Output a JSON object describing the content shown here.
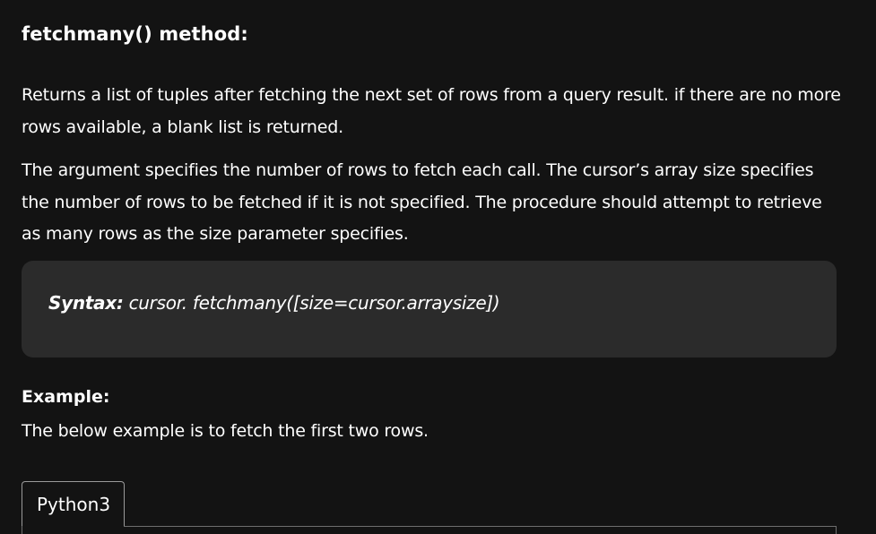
{
  "heading": "fetchmany() method:",
  "paragraphs": [
    "Returns a list of tuples after fetching the next set of rows from a query result. if there are no more rows available, a blank list is returned.",
    "The argument specifies the number of rows to fetch each call. The cursor’s array size specifies the number of rows to be fetched if it is not specified. The procedure should attempt to retrieve as many rows as the size parameter specifies."
  ],
  "syntax": {
    "label": "Syntax:",
    "code": " cursor. fetchmany([size=cursor.arraysize])"
  },
  "example": {
    "heading": "Example:",
    "description": "The below example is to fetch the first two rows."
  },
  "code_tabs": [
    "Python3"
  ],
  "colors": {
    "background": "#131313",
    "text": "#ffffff",
    "syntax_box": "#2b2b2b"
  }
}
